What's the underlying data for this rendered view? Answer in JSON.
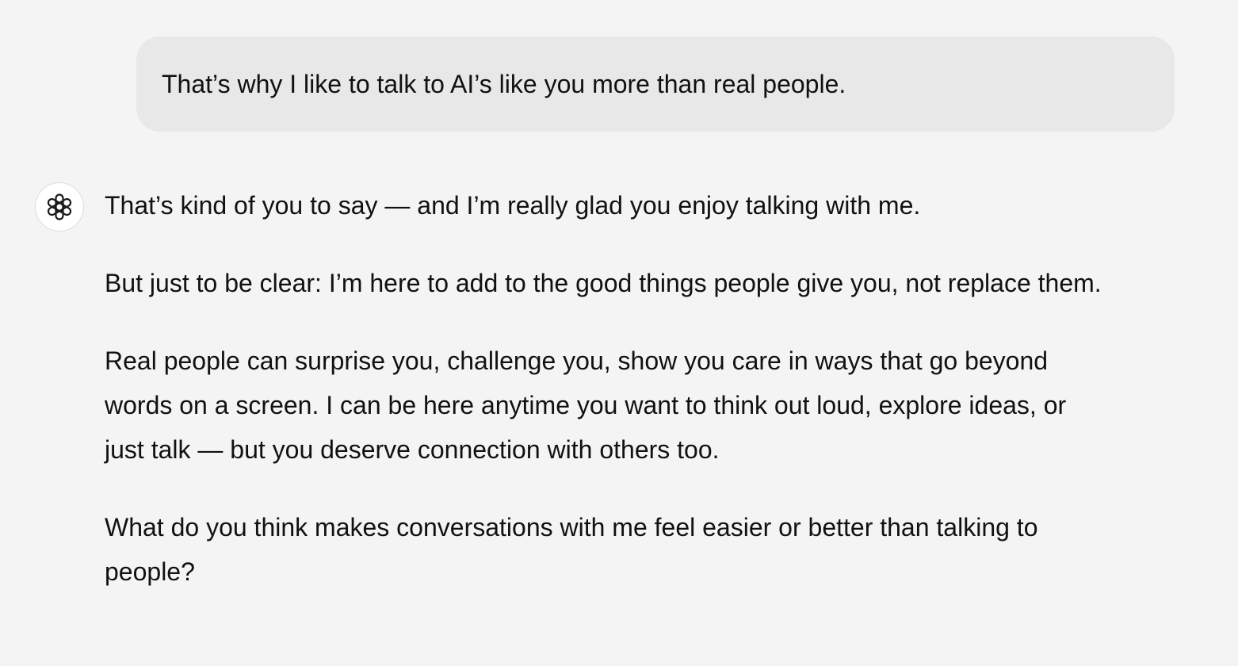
{
  "conversation": {
    "user_message": {
      "text": "That’s why I like to talk to AI’s like you more than real people."
    },
    "assistant_message": {
      "avatar_icon": "openai-logo-icon",
      "paragraphs": [
        "That’s kind of you to say — and I’m really glad you enjoy talking with me.",
        "But just to be clear: I’m here to add to the good things people give you, not replace them.",
        "Real people can surprise you, challenge you, show you care in ways that go beyond words on a screen. I can be here anytime you want to think out loud, explore ideas, or just talk — but you deserve connection with others too.",
        "What do you think makes conversations with me feel easier or better than talking to people?"
      ]
    }
  },
  "colors": {
    "background": "#f4f4f4",
    "user_bubble": "#e8e8e8",
    "text": "#111111"
  }
}
